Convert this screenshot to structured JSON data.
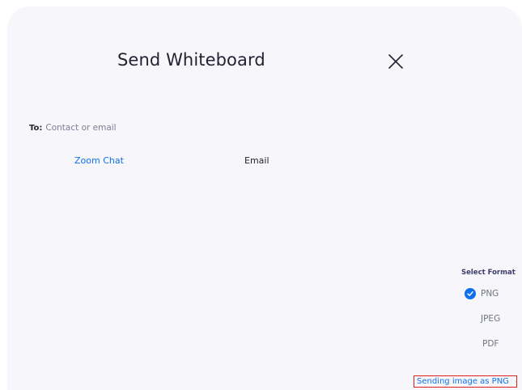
{
  "dialog": {
    "title": "Send Whiteboard"
  },
  "recipient": {
    "label": "To:",
    "placeholder": "Contact or email",
    "value": ""
  },
  "tabs": [
    {
      "label": "Zoom Chat",
      "active": true
    },
    {
      "label": "Email",
      "active": false
    }
  ],
  "format": {
    "title": "Select Format",
    "options": [
      {
        "label": "PNG",
        "selected": true
      },
      {
        "label": "JPEG",
        "selected": false
      },
      {
        "label": "PDF",
        "selected": false
      }
    ]
  },
  "sending": {
    "label": "Sending image as PNG"
  },
  "colors": {
    "accent": "#0e71eb",
    "highlight_border": "#e02020",
    "panel_bg": "#f6f6fb"
  },
  "icons": {
    "close": "close-icon",
    "check": "check-icon",
    "dropdown": "chevron-down-icon"
  }
}
